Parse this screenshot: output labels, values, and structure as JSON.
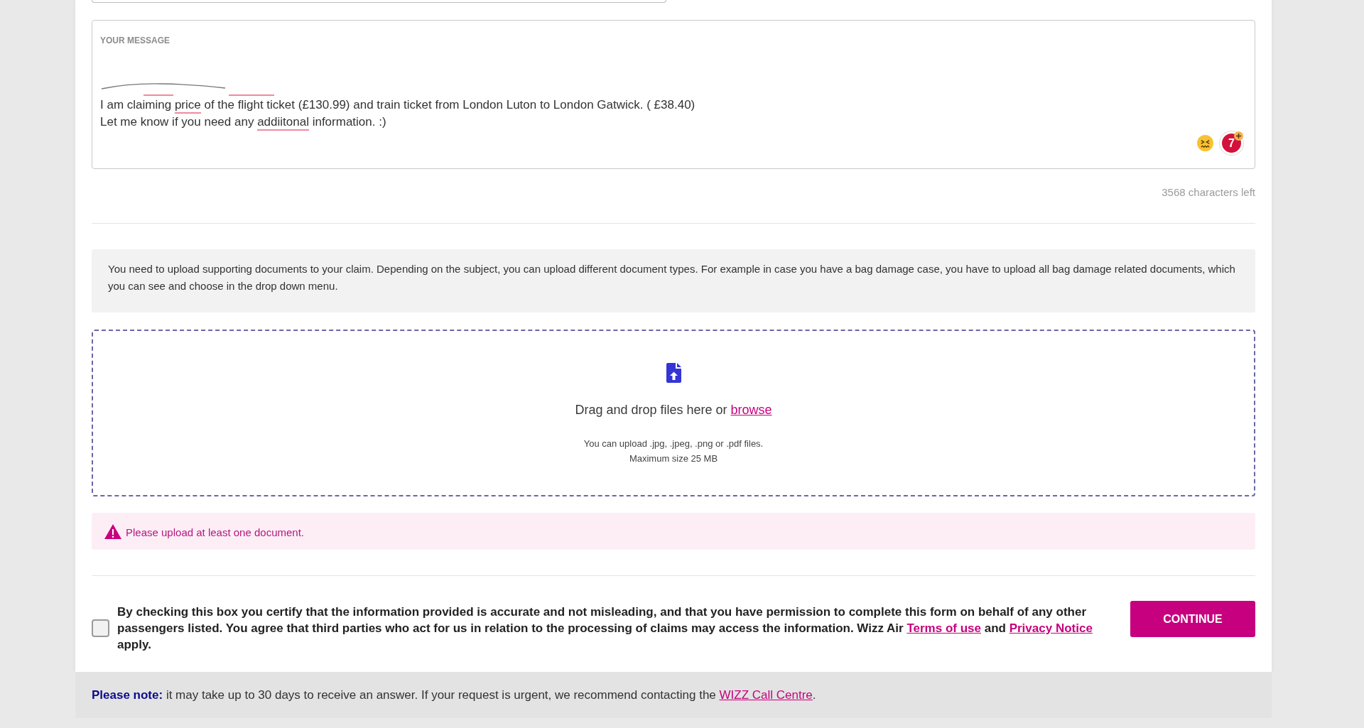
{
  "message_field": {
    "label": "YOUR MESSAGE",
    "lines": [
      {
        "segments": [
          {
            "text": "I am claiming ",
            "flagged": false
          },
          {
            "text": "price",
            "flagged": true
          },
          {
            "text": " of the flight ticket (£130.99) and train ticket from London Luton to London Gatwick. ( £38.40)",
            "flagged": false
          }
        ]
      },
      {
        "segments": [
          {
            "text": "Let me know if you need any ",
            "flagged": false
          },
          {
            "text": "addiitonal",
            "flagged": true
          },
          {
            "text": " information. :)",
            "flagged": false
          }
        ]
      }
    ],
    "assistant_badge": {
      "count": "7"
    }
  },
  "characters_left": "3568 characters left",
  "upload_info": "You need to upload supporting documents to your claim. Depending on the subject, you can upload different document types. For example in case you have a bag damage case, you have to upload all bag damage related documents, which you can see and choose in the drop down menu.",
  "drop_zone": {
    "prompt": [
      {
        "kind": "text",
        "text": "Drag and drop files here or "
      },
      {
        "kind": "link",
        "text": "browse"
      }
    ],
    "formats": "You can upload .jpg, .jpeg, .png or .pdf files.",
    "max_size": "Maximum size 25 MB"
  },
  "error": {
    "message": "Please upload at least one document."
  },
  "consent": {
    "checked": false,
    "segments": [
      {
        "kind": "text",
        "text": "By checking this box you certify that the information provided is accurate and not misleading, and that you have permission to complete this form on behalf of any other passengers listed. You agree that third parties who act for us in relation to the processing of claims may access the information. Wizz Air "
      },
      {
        "kind": "link",
        "text": "Terms of use"
      },
      {
        "kind": "text",
        "text": " and "
      },
      {
        "kind": "link",
        "text": "Privacy Notice"
      },
      {
        "kind": "text",
        "text": " apply."
      }
    ]
  },
  "continue_button": {
    "label": "CONTINUE"
  },
  "footer_note": {
    "segments": [
      {
        "kind": "text",
        "text": "**Please note:** it may take up to 30 days to receive an answer. If your request is urgent, we recommend contacting the "
      },
      {
        "kind": "link",
        "text": "WIZZ Call Centre"
      },
      {
        "kind": "text",
        "text": "."
      }
    ]
  }
}
